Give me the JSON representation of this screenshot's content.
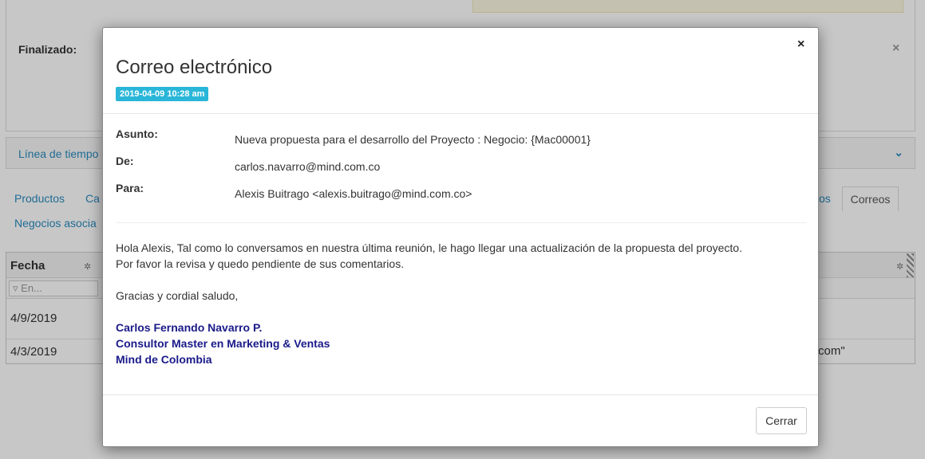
{
  "background": {
    "finalizado_label": "Finalizado:",
    "timeline_label": "Línea de tiempo",
    "tabs": [
      "Productos",
      "Ca",
      "os",
      "Correos",
      "Negocios asocia"
    ],
    "grid": {
      "header": "Fecha",
      "filter_placeholder": "En...",
      "rows": [
        "4/9/2019",
        "4/3/2019"
      ],
      "trailing_text": "com\""
    }
  },
  "modal": {
    "title": "Correo electrónico",
    "date_badge": "2019-04-09 10:28 am",
    "close_icon": "×",
    "fields": {
      "subject_label": "Asunto:",
      "subject_value": "Nueva propuesta para el desarrollo del Proyecto : Negocio: {Mac00001}",
      "from_label": "De:",
      "from_value": "carlos.navarro@mind.com.co",
      "to_label": "Para:",
      "to_value": "Alexis Buitrago <alexis.buitrago@mind.com.co>"
    },
    "body": {
      "line1": "Hola Alexis, Tal como lo conversamos en nuestra última reunión, le hago llegar una actualización de la propuesta del proyecto.",
      "line2": "Por favor la revisa y quedo pendiente de sus comentarios.",
      "line3": "Gracias y cordial saludo,"
    },
    "signature": {
      "name": "Carlos Fernando Navarro P.",
      "role": "Consultor Master en Marketing & Ventas",
      "company": "Mind de Colombia"
    },
    "footer": {
      "close_button": "Cerrar"
    }
  }
}
